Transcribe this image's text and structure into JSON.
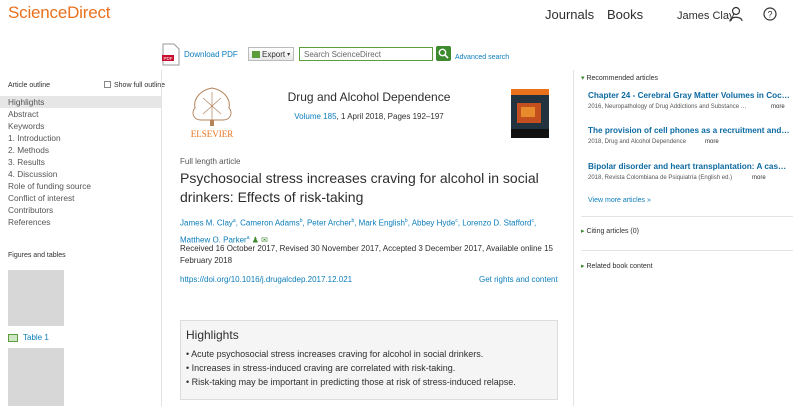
{
  "header": {
    "logo": "ScienceDirect",
    "nav": {
      "journals": "Journals",
      "books": "Books"
    },
    "user_name": "James Clay"
  },
  "toolbar": {
    "download_pdf": "Download PDF",
    "export": "Export",
    "search_placeholder": "Search ScienceDirect",
    "advanced_search": "Advanced search"
  },
  "outline": {
    "title": "Article outline",
    "show_full": "Show full outline",
    "items": [
      "Highlights",
      "Abstract",
      "Keywords",
      "1. Introduction",
      "2. Methods",
      "3. Results",
      "4. Discussion",
      "Role of funding source",
      "Conflict of interest",
      "Contributors",
      "References"
    ],
    "figures_title": "Figures and tables",
    "table_label": "Table 1"
  },
  "article": {
    "journal_name": "Drug and Alcohol Dependence",
    "volume_link": "Volume 185",
    "volume_rest": ", 1 April 2018, Pages 192–197",
    "type": "Full length article",
    "title": "Psychosocial stress increases craving for alcohol in social drinkers: Effects of risk-taking",
    "authors": [
      {
        "name": "James M. Clay",
        "sup": "a"
      },
      {
        "name": "Cameron Adams",
        "sup": "b"
      },
      {
        "name": "Peter Archer",
        "sup": "b"
      },
      {
        "name": "Mark English",
        "sup": "b"
      },
      {
        "name": "Abbey Hyde",
        "sup": "c"
      },
      {
        "name": "Lorenzo D. Stafford",
        "sup": "c"
      },
      {
        "name": "Matthew O. Parker",
        "sup": "a"
      }
    ],
    "dates": "Received 16 October 2017, Revised 30 November 2017, Accepted 3 December 2017, Available online 15 February 2018",
    "doi": "https://doi.org/10.1016/j.drugalcdep.2017.12.021",
    "rights": "Get rights and content",
    "highlights_title": "Highlights",
    "highlights": [
      "Acute psychosocial stress increases craving for alcohol in social drinkers.",
      "Increases in stress-induced craving are correlated with risk-taking.",
      "Risk-taking may be important in predicting those at risk of stress-induced relapse."
    ]
  },
  "sidebar": {
    "recommended_title": "Recommended articles",
    "recommended": [
      {
        "title": "Chapter 24 - Cerebral Gray Matter Volumes in Coc…",
        "meta": "2016, Neuropathology of Drug Addictions and Substance …",
        "more": "more"
      },
      {
        "title": "The provision of cell phones as a recruitment and…",
        "meta": "2018, Drug and Alcohol Dependence",
        "more": "more"
      },
      {
        "title": "Bipolar disorder and heart transplantation: A cas…",
        "meta": "2018, Revista Colombiana de Psiquiatría (English ed.)",
        "more": "more"
      }
    ],
    "view_more": "View more articles »",
    "citing": "Citing articles (0)",
    "related": "Related book content"
  },
  "colors": {
    "brand_orange": "#e9711c",
    "link_blue": "#0c7dbb",
    "accent_green": "#3d8a2f"
  }
}
